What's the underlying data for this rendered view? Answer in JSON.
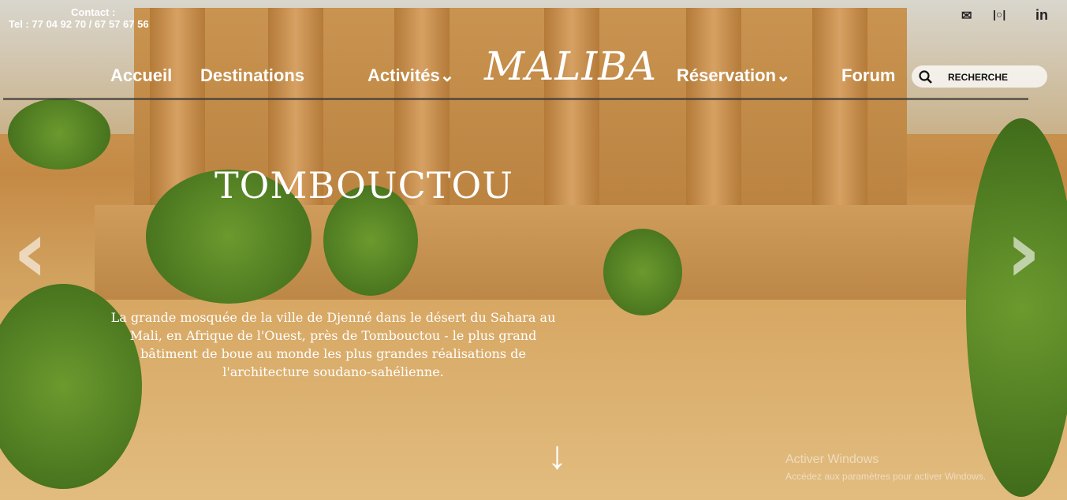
{
  "contact": {
    "label": "Contact :",
    "phones": "Tel : 77 04 92 70 / 67 57 67 56"
  },
  "nav": {
    "accueil": "Accueil",
    "destinations": "Destinations",
    "activites": "Activités",
    "activites_chevron": "⌄",
    "logo": "MALIBA",
    "reservation": "Réservation",
    "reservation_chevron": "⌄",
    "forum": "Forum"
  },
  "search": {
    "label": "RECHERCHE"
  },
  "social": {
    "mail": "✉",
    "instagram": "|○|",
    "linkedin": "in"
  },
  "hero": {
    "title": "TOMBOUCTOU",
    "description": "La grande mosquée de la ville de Djenné dans le désert du Sahara au Mali, en Afrique de l'Ouest, près de Tombouctou - le plus grand bâtiment de boue au monde les plus grandes réalisations de l'architecture soudano-sahélienne."
  },
  "carousel": {
    "prev": "‹",
    "next": "›",
    "down": "↓"
  },
  "watermark": {
    "line1": "Activer Windows",
    "line2": "Accédez aux paramètres pour activer Windows."
  }
}
